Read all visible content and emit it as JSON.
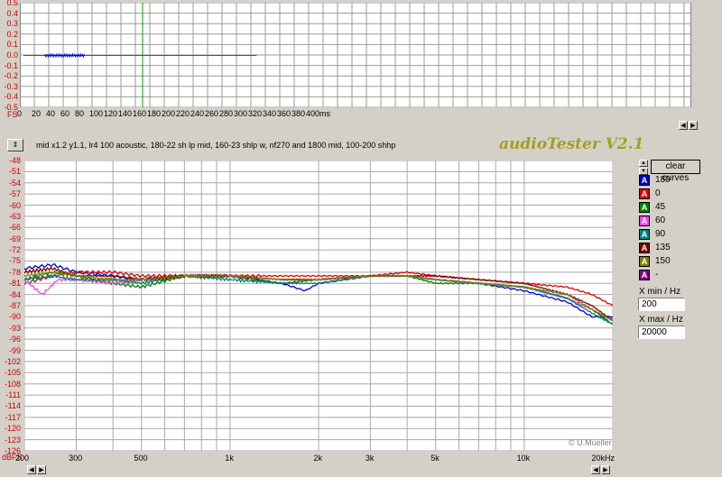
{
  "scope": {
    "y_ticks": [
      "0.5",
      "0.4",
      "0.3",
      "0.2",
      "0.1",
      "0.0",
      "-0.1",
      "-0.2",
      "-0.3",
      "-0.4",
      "-0.5"
    ],
    "y_top_label": "FS",
    "x_ticks": [
      "0",
      "20",
      "40",
      "60",
      "80",
      "100",
      "120",
      "140",
      "160",
      "180",
      "200",
      "220",
      "240",
      "260",
      "280",
      "300",
      "320",
      "340",
      "360",
      "380",
      "400ms"
    ],
    "x_range": [
      0,
      400
    ],
    "cursor_ms": 170
  },
  "info_text": "mid x1.2 y1.1, lr4 100 acoustic, 180-22 sh lp mid, 160-23 shlp w, nf270 and 1800 mid, 100-200 shhp",
  "app_title": "audioTester V2.1",
  "clear_button": "clear curves",
  "credit": "© U.Mueller",
  "xmin_label": "X min / Hz",
  "xmin_value": "200",
  "xmax_label": "X max / Hz",
  "xmax_value": "20000",
  "legend": [
    {
      "icon": "A",
      "label": "180",
      "color": "#0000cc"
    },
    {
      "icon": "A",
      "label": "0",
      "color": "#dd0000"
    },
    {
      "icon": "A",
      "label": "45",
      "color": "#008000"
    },
    {
      "icon": "A",
      "label": "60",
      "color": "#ee44ee"
    },
    {
      "icon": "A",
      "label": "90",
      "color": "#008080"
    },
    {
      "icon": "A",
      "label": "135",
      "color": "#800000"
    },
    {
      "icon": "A",
      "label": "150",
      "color": "#808000"
    },
    {
      "icon": "A",
      "label": "-",
      "color": "#800080"
    }
  ],
  "chart_data": {
    "type": "line",
    "ylabel": "dBFS",
    "x_scale": "log",
    "xlim": [
      200,
      20000
    ],
    "ylim": [
      -126,
      -48
    ],
    "y_ticks": [
      "-48",
      "-51",
      "-54",
      "-57",
      "-60",
      "-63",
      "-66",
      "-69",
      "-72",
      "-75",
      "-78",
      "-81",
      "-84",
      "-87",
      "-90",
      "-93",
      "-96",
      "-99",
      "-102",
      "-105",
      "-108",
      "-111",
      "-114",
      "-117",
      "-120",
      "-123",
      "-126"
    ],
    "x_ticks": [
      "200",
      "300",
      "500",
      "1k",
      "2k",
      "3k",
      "5k",
      "10k",
      "20kHz"
    ],
    "x_tick_values": [
      200,
      300,
      500,
      1000,
      2000,
      3000,
      5000,
      10000,
      20000
    ],
    "series": [
      {
        "name": "180",
        "color": "#0000cc",
        "x": [
          200,
          250,
          300,
          400,
          500,
          700,
          1000,
          1500,
          1800,
          2000,
          3000,
          4000,
          5000,
          7000,
          10000,
          14000,
          17000,
          20000
        ],
        "y": [
          -77,
          -76,
          -78,
          -79,
          -80,
          -79,
          -79,
          -81,
          -83,
          -81,
          -79,
          -79,
          -80,
          -81,
          -83,
          -86,
          -90,
          -90
        ]
      },
      {
        "name": "0",
        "color": "#dd0000",
        "x": [
          200,
          250,
          300,
          400,
          500,
          700,
          1000,
          1500,
          2000,
          3000,
          4000,
          5000,
          7000,
          10000,
          14000,
          17000,
          20000
        ],
        "y": [
          -81,
          -79,
          -78,
          -78,
          -79,
          -79,
          -79,
          -79,
          -79,
          -79,
          -78,
          -79,
          -80,
          -81,
          -82,
          -84,
          -87
        ]
      },
      {
        "name": "45",
        "color": "#008000",
        "x": [
          200,
          250,
          300,
          400,
          500,
          700,
          1000,
          1500,
          2000,
          3000,
          4000,
          5000,
          7000,
          10000,
          14000,
          17000,
          20000
        ],
        "y": [
          -80,
          -78,
          -79,
          -81,
          -82,
          -79,
          -79,
          -81,
          -80,
          -79,
          -79,
          -81,
          -81,
          -82,
          -85,
          -88,
          -92
        ]
      },
      {
        "name": "60",
        "color": "#ee44ee",
        "x": [
          200,
          230,
          260,
          300,
          400,
          500,
          700,
          1000,
          1500,
          2000,
          3000,
          4000,
          5000,
          7000,
          10000,
          14000,
          17000,
          20000
        ],
        "y": [
          -80,
          -84,
          -80,
          -80,
          -81,
          -80,
          -79,
          -79,
          -80,
          -80,
          -79,
          -79,
          -80,
          -81,
          -82,
          -85,
          -88,
          -91
        ]
      },
      {
        "name": "90",
        "color": "#008080",
        "x": [
          200,
          250,
          300,
          400,
          500,
          700,
          1000,
          1500,
          2000,
          3000,
          4000,
          5000,
          7000,
          10000,
          14000,
          17000,
          20000
        ],
        "y": [
          -80,
          -79,
          -80,
          -80,
          -81,
          -79,
          -80,
          -81,
          -81,
          -79,
          -79,
          -80,
          -81,
          -82,
          -85,
          -89,
          -92
        ]
      },
      {
        "name": "135",
        "color": "#800000",
        "x": [
          200,
          250,
          300,
          400,
          500,
          700,
          1000,
          1500,
          2000,
          3000,
          4000,
          5000,
          7000,
          10000,
          14000,
          17000,
          20000
        ],
        "y": [
          -78,
          -77,
          -79,
          -79,
          -80,
          -79,
          -79,
          -80,
          -80,
          -79,
          -79,
          -79,
          -80,
          -81,
          -84,
          -87,
          -91
        ]
      },
      {
        "name": "150",
        "color": "#808000",
        "x": [
          200,
          250,
          300,
          400,
          500,
          700,
          1000,
          1500,
          2000,
          3000,
          4000,
          5000,
          7000,
          10000,
          14000,
          17000,
          20000
        ],
        "y": [
          -79,
          -78,
          -79,
          -80,
          -80,
          -79,
          -79,
          -80,
          -80,
          -79,
          -79,
          -80,
          -81,
          -82,
          -84,
          -88,
          -91
        ]
      }
    ]
  },
  "scope_trace": {
    "color": "#cc00cc",
    "noise_color": "#0000cc",
    "x_ms": [
      5,
      358
    ]
  }
}
